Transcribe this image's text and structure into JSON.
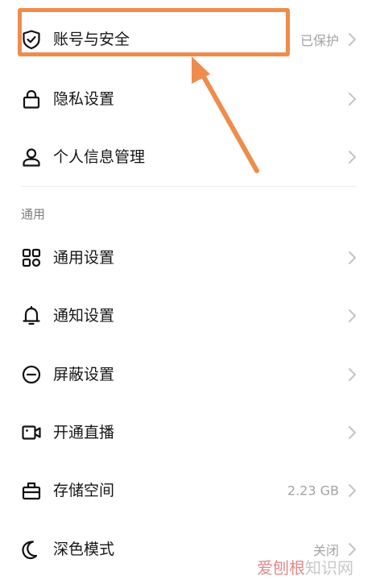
{
  "account": {
    "security": {
      "label": "账号与安全",
      "value": "已保护"
    },
    "privacy": {
      "label": "隐私设置"
    },
    "personal": {
      "label": "个人信息管理"
    }
  },
  "general_section": {
    "header": "通用",
    "items": [
      {
        "label": "通用设置",
        "icon": "grid-icon"
      },
      {
        "label": "通知设置",
        "icon": "bell-icon"
      },
      {
        "label": "屏蔽设置",
        "icon": "block-icon"
      },
      {
        "label": "开通直播",
        "icon": "video-camera-icon"
      },
      {
        "label": "存储空间",
        "icon": "storage-box-icon",
        "value": "2.23 GB"
      },
      {
        "label": "深色模式",
        "icon": "moon-icon",
        "value": "关闭"
      }
    ]
  },
  "annotation": {
    "color": "#ef8c4c"
  },
  "watermark": {
    "brand": "爱刨根",
    "text": "知识网"
  }
}
